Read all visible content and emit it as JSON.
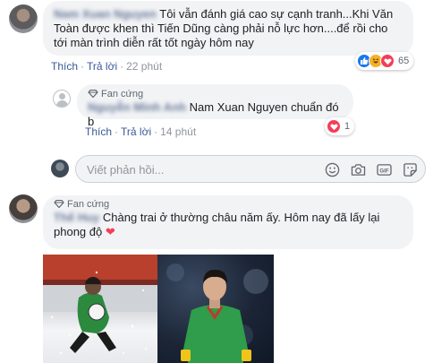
{
  "comments": [
    {
      "author": "Nam Xuan Nguyen",
      "text": "Tôi vẫn đánh giá cao sự cạnh tranh...Khi Văn Toàn được khen thì Tiến Dũng càng phải nỗ lực hơn....để rồi cho tới màn trình diễn rất tốt ngày hôm nay",
      "actions": {
        "like": "Thích",
        "reply": "Trả lời",
        "time": "22 phút"
      },
      "reaction_count": "65"
    },
    {
      "badge": "Fan cứng",
      "author": "Nguyễn Minh Anh",
      "text": "Nam Xuan Nguyen chuẩn đó b",
      "actions": {
        "like": "Thích",
        "reply": "Trả lời",
        "time": "14 phút"
      },
      "reaction_count": "1"
    },
    {
      "badge": "Fan cứng",
      "author": "Thế Huy",
      "text": "Chàng trai ở thường châu năm ấy. Hôm nay đã lấy lại phong độ",
      "heart": "❤"
    }
  ],
  "composer": {
    "placeholder": "Viết phản hồi..."
  },
  "colors": {
    "link": "#385898",
    "bubble": "#f2f3f5",
    "heart": "#f33e58",
    "like": "#1877f2"
  },
  "icons": [
    "emoji-icon",
    "camera-icon",
    "gif-icon",
    "sticker-icon",
    "fan-badge-icon",
    "like-reaction-icon",
    "haha-reaction-icon",
    "heart-reaction-icon"
  ]
}
